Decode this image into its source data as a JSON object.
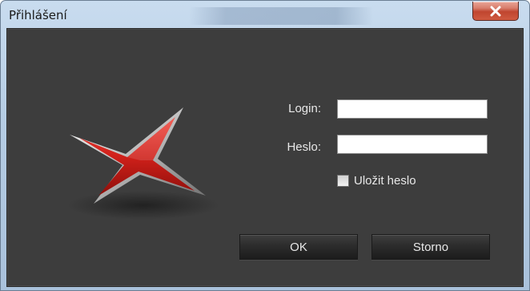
{
  "window": {
    "title": "Přihlášení"
  },
  "form": {
    "login_label": "Login:",
    "login_value": "",
    "password_label": "Heslo:",
    "password_value": "",
    "remember_label": "Uložit heslo",
    "remember_checked": false
  },
  "buttons": {
    "ok_label": "OK",
    "cancel_label": "Storno"
  },
  "colors": {
    "client_background": "#3d3d3d",
    "logo_red": "#d0201a",
    "close_button": "#c0452f"
  },
  "icons": {
    "close": "close-icon",
    "logo": "x-logo-icon"
  }
}
